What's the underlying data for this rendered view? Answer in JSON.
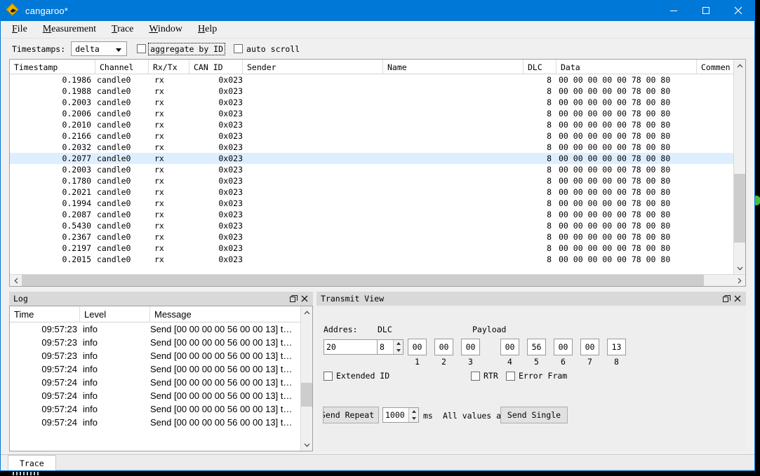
{
  "window": {
    "title": "cangaroo*",
    "icon": "kangaroo-diamond-icon",
    "minimize_label": "Minimize",
    "maximize_label": "Maximize",
    "close_label": "Close"
  },
  "menubar": {
    "items": [
      {
        "accel": "F",
        "rest": "ile"
      },
      {
        "accel": "M",
        "rest": "easurement"
      },
      {
        "accel": "T",
        "rest": "race"
      },
      {
        "accel": "W",
        "rest": "indow"
      },
      {
        "accel": "H",
        "rest": "elp"
      }
    ]
  },
  "toolbar": {
    "timestamps_label": "Timestamps:",
    "timestamps_value": "delta",
    "aggregate_label": "aggregate by ID",
    "aggregate_checked": false,
    "autoscroll_label": "auto scroll",
    "autoscroll_checked": false
  },
  "trace": {
    "columns": [
      "Timestamp",
      "Channel",
      "Rx/Tx",
      "CAN ID",
      "Sender",
      "Name",
      "DLC",
      "Data",
      "Comment"
    ],
    "comment_clipped": "Commen",
    "rows": [
      {
        "timestamp": "0.1986",
        "channel": "candle0",
        "rxtx": "rx",
        "canid": "0x023",
        "sender": "",
        "name": "",
        "dlc": "8",
        "data": "00 00 00 00 00 78 00 80",
        "selected": false
      },
      {
        "timestamp": "0.1988",
        "channel": "candle0",
        "rxtx": "rx",
        "canid": "0x023",
        "sender": "",
        "name": "",
        "dlc": "8",
        "data": "00 00 00 00 00 78 00 80",
        "selected": false
      },
      {
        "timestamp": "0.2003",
        "channel": "candle0",
        "rxtx": "rx",
        "canid": "0x023",
        "sender": "",
        "name": "",
        "dlc": "8",
        "data": "00 00 00 00 00 78 00 80",
        "selected": false
      },
      {
        "timestamp": "0.2006",
        "channel": "candle0",
        "rxtx": "rx",
        "canid": "0x023",
        "sender": "",
        "name": "",
        "dlc": "8",
        "data": "00 00 00 00 00 78 00 80",
        "selected": false
      },
      {
        "timestamp": "0.2010",
        "channel": "candle0",
        "rxtx": "rx",
        "canid": "0x023",
        "sender": "",
        "name": "",
        "dlc": "8",
        "data": "00 00 00 00 00 78 00 80",
        "selected": false
      },
      {
        "timestamp": "0.2166",
        "channel": "candle0",
        "rxtx": "rx",
        "canid": "0x023",
        "sender": "",
        "name": "",
        "dlc": "8",
        "data": "00 00 00 00 00 78 00 80",
        "selected": false
      },
      {
        "timestamp": "0.2032",
        "channel": "candle0",
        "rxtx": "rx",
        "canid": "0x023",
        "sender": "",
        "name": "",
        "dlc": "8",
        "data": "00 00 00 00 00 78 00 80",
        "selected": false
      },
      {
        "timestamp": "0.2077",
        "channel": "candle0",
        "rxtx": "rx",
        "canid": "0x023",
        "sender": "",
        "name": "",
        "dlc": "8",
        "data": "00 00 00 00 00 78 00 80",
        "selected": true
      },
      {
        "timestamp": "0.2003",
        "channel": "candle0",
        "rxtx": "rx",
        "canid": "0x023",
        "sender": "",
        "name": "",
        "dlc": "8",
        "data": "00 00 00 00 00 78 00 80",
        "selected": false
      },
      {
        "timestamp": "0.1780",
        "channel": "candle0",
        "rxtx": "rx",
        "canid": "0x023",
        "sender": "",
        "name": "",
        "dlc": "8",
        "data": "00 00 00 00 00 78 00 80",
        "selected": false
      },
      {
        "timestamp": "0.2021",
        "channel": "candle0",
        "rxtx": "rx",
        "canid": "0x023",
        "sender": "",
        "name": "",
        "dlc": "8",
        "data": "00 00 00 00 00 78 00 80",
        "selected": false
      },
      {
        "timestamp": "0.1994",
        "channel": "candle0",
        "rxtx": "rx",
        "canid": "0x023",
        "sender": "",
        "name": "",
        "dlc": "8",
        "data": "00 00 00 00 00 78 00 80",
        "selected": false
      },
      {
        "timestamp": "0.2087",
        "channel": "candle0",
        "rxtx": "rx",
        "canid": "0x023",
        "sender": "",
        "name": "",
        "dlc": "8",
        "data": "00 00 00 00 00 78 00 80",
        "selected": false
      },
      {
        "timestamp": "0.5430",
        "channel": "candle0",
        "rxtx": "rx",
        "canid": "0x023",
        "sender": "",
        "name": "",
        "dlc": "8",
        "data": "00 00 00 00 00 78 00 80",
        "selected": false
      },
      {
        "timestamp": "0.2367",
        "channel": "candle0",
        "rxtx": "rx",
        "canid": "0x023",
        "sender": "",
        "name": "",
        "dlc": "8",
        "data": "00 00 00 00 00 78 00 80",
        "selected": false
      },
      {
        "timestamp": "0.2197",
        "channel": "candle0",
        "rxtx": "rx",
        "canid": "0x023",
        "sender": "",
        "name": "",
        "dlc": "8",
        "data": "00 00 00 00 00 78 00 80",
        "selected": false
      },
      {
        "timestamp": "0.2015",
        "channel": "candle0",
        "rxtx": "rx",
        "canid": "0x023",
        "sender": "",
        "name": "",
        "dlc": "8",
        "data": "00 00 00 00 00 78 00 80",
        "selected": false
      }
    ]
  },
  "log": {
    "title": "Log",
    "columns": [
      "Time",
      "Level",
      "Message"
    ],
    "rows": [
      {
        "time": "09:57:23",
        "level": "info",
        "message": "Send [00 00 00 00 56 00 00 13] t…"
      },
      {
        "time": "09:57:23",
        "level": "info",
        "message": "Send [00 00 00 00 56 00 00 13] t…"
      },
      {
        "time": "09:57:23",
        "level": "info",
        "message": "Send [00 00 00 00 56 00 00 13] t…"
      },
      {
        "time": "09:57:24",
        "level": "info",
        "message": "Send [00 00 00 00 56 00 00 13] t…"
      },
      {
        "time": "09:57:24",
        "level": "info",
        "message": "Send [00 00 00 00 56 00 00 13] t…"
      },
      {
        "time": "09:57:24",
        "level": "info",
        "message": "Send [00 00 00 00 56 00 00 13] t…"
      },
      {
        "time": "09:57:24",
        "level": "info",
        "message": "Send [00 00 00 00 56 00 00 13] t…"
      },
      {
        "time": "09:57:24",
        "level": "info",
        "message": "Send [00 00 00 00 56 00 00 13] t…"
      }
    ]
  },
  "transmit": {
    "title": "Transmit View",
    "address_label": "Addres:",
    "address_value": "20",
    "dlc_label": "DLC",
    "dlc_value": "8",
    "payload_label": "Payload",
    "payload": [
      {
        "index": "1",
        "value": "00"
      },
      {
        "index": "2",
        "value": "00"
      },
      {
        "index": "3",
        "value": "00"
      },
      {
        "index": "4",
        "value": "00"
      },
      {
        "index": "5",
        "value": "56"
      },
      {
        "index": "6",
        "value": "00"
      },
      {
        "index": "7",
        "value": "00"
      },
      {
        "index": "8",
        "value": "13"
      }
    ],
    "extended_id_label": "Extended ID",
    "extended_id_checked": false,
    "rtr_label": "RTR",
    "rtr_checked": false,
    "error_frame_label": "Error Fram",
    "error_frame_checked": false,
    "send_repeat_label": "Send Repeat",
    "interval_value": "1000",
    "interval_unit": "ms",
    "hint_text": "All values are ",
    "send_single_label": "Send Single"
  },
  "tabs": {
    "items": [
      {
        "label": "Trace",
        "active": true
      }
    ]
  }
}
